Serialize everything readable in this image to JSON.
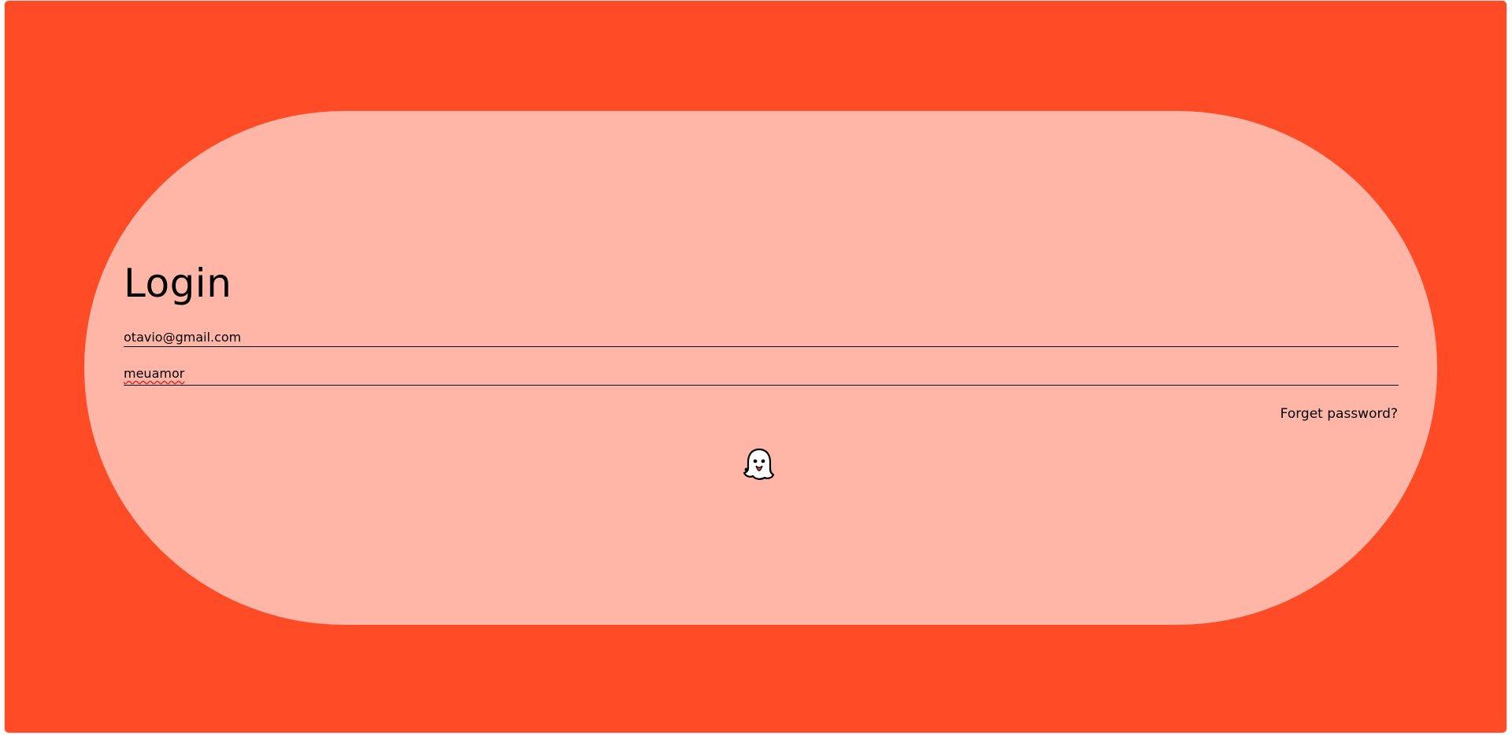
{
  "login": {
    "title": "Login",
    "email_value": "otavio@gmail.com",
    "password_value": "meuamor",
    "forgot_label": "Forget password?",
    "submit_icon": "ghost-icon"
  },
  "colors": {
    "background": "#ff4b26",
    "card": "#ffb6a7",
    "text": "#000000"
  }
}
